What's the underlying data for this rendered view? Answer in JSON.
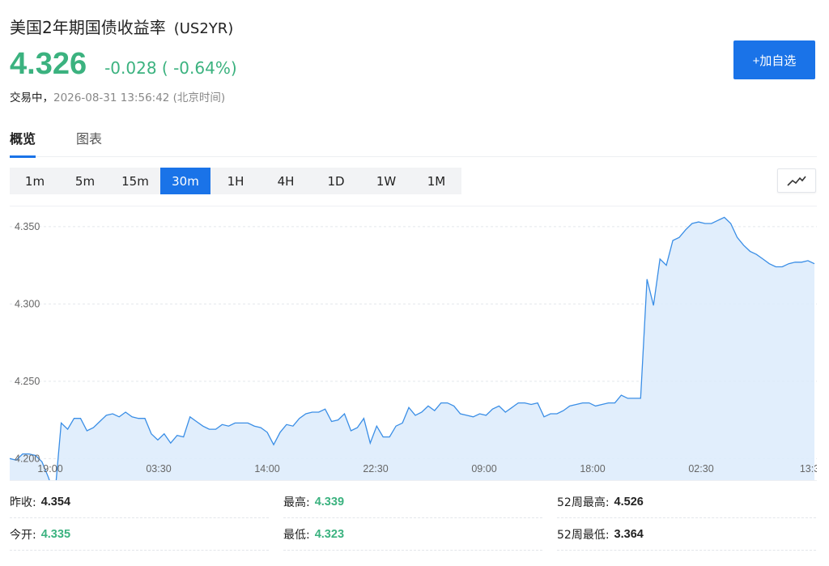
{
  "header": {
    "title": "美国2年期国债收益率",
    "symbol": "(US2YR)",
    "price": "4.326",
    "change": "-0.028 ( -0.64%)",
    "state": "交易中，",
    "timestamp": "2026-08-31 13:56:42 (北京时间)",
    "add_label": "+加自选"
  },
  "tabs": [
    {
      "label": "概览",
      "active": true
    },
    {
      "label": "图表",
      "active": false
    }
  ],
  "ranges": [
    {
      "label": "1m",
      "active": false
    },
    {
      "label": "5m",
      "active": false
    },
    {
      "label": "15m",
      "active": false
    },
    {
      "label": "30m",
      "active": true
    },
    {
      "label": "1H",
      "active": false
    },
    {
      "label": "4H",
      "active": false
    },
    {
      "label": "1D",
      "active": false
    },
    {
      "label": "1W",
      "active": false
    },
    {
      "label": "1M",
      "active": false
    }
  ],
  "chart_data": {
    "type": "area",
    "ylim": [
      4.185,
      4.363
    ],
    "y_ticks": [
      "4.350",
      "4.300",
      "4.250",
      "4.200"
    ],
    "x_ticks": [
      "19:00",
      "03:30",
      "14:00",
      "22:30",
      "09:00",
      "18:00",
      "02:30",
      "13:3"
    ],
    "grid": true,
    "line_color": "#3a8ee6",
    "fill_color": "#dcebfb",
    "values": [
      4.2,
      4.199,
      4.203,
      4.203,
      4.202,
      4.198,
      4.188,
      4.176,
      4.223,
      4.219,
      4.226,
      4.226,
      4.218,
      4.22,
      4.224,
      4.228,
      4.229,
      4.227,
      4.23,
      4.227,
      4.226,
      4.226,
      4.216,
      4.212,
      4.216,
      4.21,
      4.215,
      4.214,
      4.227,
      4.224,
      4.221,
      4.219,
      4.219,
      4.222,
      4.221,
      4.223,
      4.223,
      4.223,
      4.221,
      4.22,
      4.217,
      4.209,
      4.217,
      4.222,
      4.221,
      4.226,
      4.229,
      4.23,
      4.23,
      4.232,
      4.224,
      4.225,
      4.229,
      4.218,
      4.22,
      4.226,
      4.21,
      4.221,
      4.214,
      4.214,
      4.221,
      4.223,
      4.233,
      4.228,
      4.23,
      4.234,
      4.231,
      4.236,
      4.236,
      4.234,
      4.229,
      4.228,
      4.227,
      4.229,
      4.228,
      4.232,
      4.234,
      4.23,
      4.233,
      4.236,
      4.236,
      4.235,
      4.236,
      4.227,
      4.229,
      4.229,
      4.231,
      4.234,
      4.235,
      4.236,
      4.236,
      4.234,
      4.235,
      4.236,
      4.236,
      4.241,
      4.239,
      4.239,
      4.239,
      4.316,
      4.299,
      4.329,
      4.325,
      4.341,
      4.343,
      4.348,
      4.352,
      4.353,
      4.352,
      4.352,
      4.354,
      4.356,
      4.352,
      4.343,
      4.338,
      4.334,
      4.332,
      4.329,
      4.326,
      4.324,
      4.324,
      4.326,
      4.327,
      4.327,
      4.328,
      4.326
    ]
  },
  "stats": {
    "prev_close_label": "昨收:",
    "prev_close": "4.354",
    "open_label": "今开:",
    "open": "4.335",
    "high_label": "最高:",
    "high": "4.339",
    "low_label": "最低:",
    "low": "4.323",
    "w52_high_label": "52周最高:",
    "w52_high": "4.526",
    "w52_low_label": "52周最低:",
    "w52_low": "3.364"
  },
  "colors": {
    "up_green": "#3bb27f",
    "accent": "#1a73e8"
  }
}
